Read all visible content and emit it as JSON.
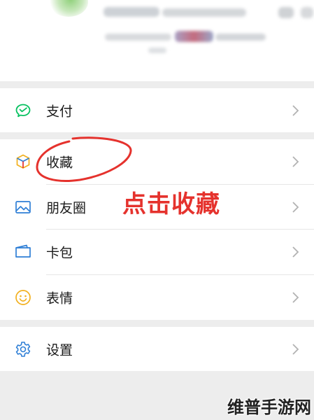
{
  "menu": {
    "pay": {
      "label": "支付",
      "icon": "wechat-pay-icon",
      "color": "#07c160"
    },
    "favorites": {
      "label": "收藏",
      "icon": "favorites-cube-icon"
    },
    "moments": {
      "label": "朋友圈",
      "icon": "image-icon",
      "color": "#2f7fd6"
    },
    "cards": {
      "label": "卡包",
      "icon": "card-wallet-icon",
      "color": "#2f7fd6"
    },
    "stickers": {
      "label": "表情",
      "icon": "smiley-icon",
      "color": "#f2b01e"
    },
    "settings": {
      "label": "设置",
      "icon": "gear-icon",
      "color": "#2f7fd6"
    }
  },
  "annotation": {
    "text": "点击收藏",
    "color": "#e5322d"
  },
  "watermark": {
    "text": "维普手游网"
  }
}
